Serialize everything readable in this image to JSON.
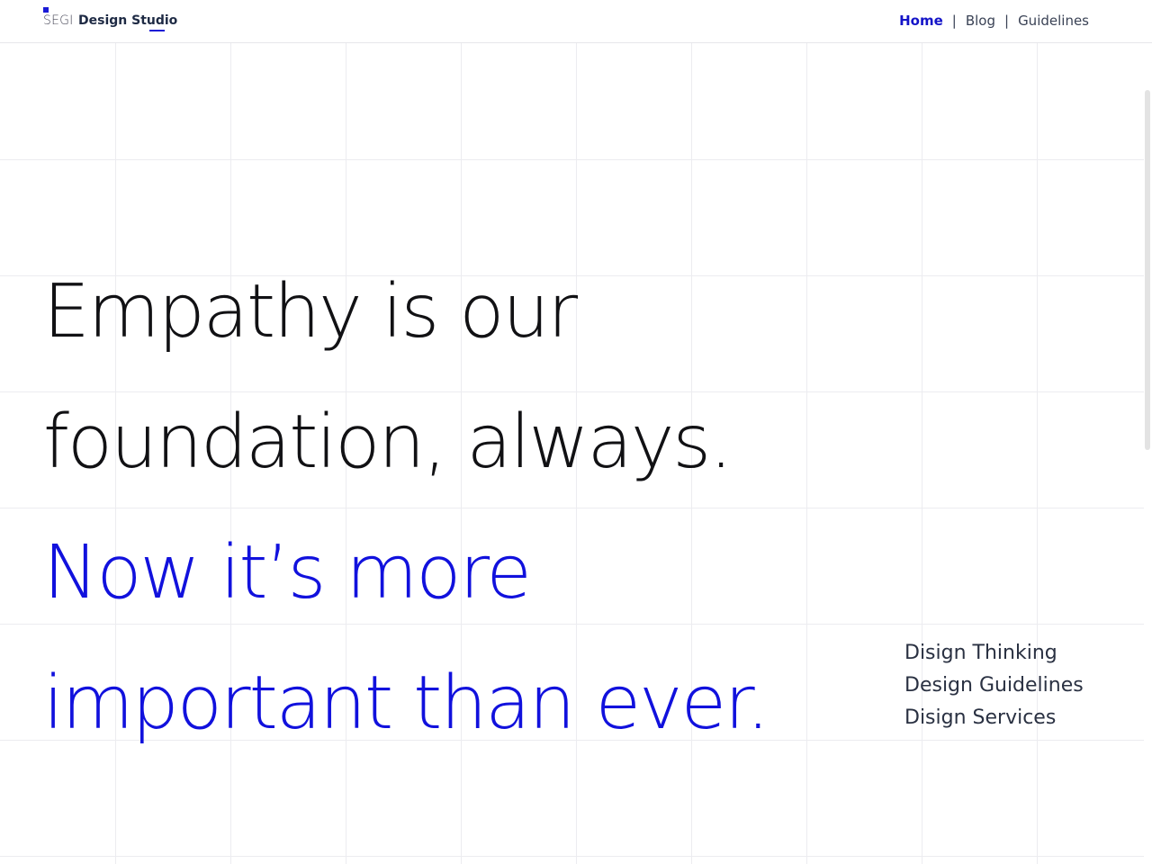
{
  "header": {
    "brand_prefix": "SEGI",
    "brand_name": "Design Studio",
    "nav": [
      {
        "label": "Home",
        "active": true
      },
      {
        "label": "Blog",
        "active": false
      },
      {
        "label": "Guidelines",
        "active": false
      }
    ],
    "separator": "|"
  },
  "hero": {
    "lines": [
      {
        "text": "Empathy is our",
        "color": "#111114"
      },
      {
        "text": "foundation, always.",
        "color": "#111114"
      },
      {
        "text": "Now it’s more",
        "color": "#1111dd"
      },
      {
        "text": "important than ever.",
        "color": "#1111dd"
      }
    ]
  },
  "side_links": [
    "Disign Thinking",
    "Design Guidelines",
    "Disign Services"
  ],
  "colors": {
    "accent": "#1414c8",
    "text_dark": "#111114",
    "grid_line": "#ececf0"
  }
}
